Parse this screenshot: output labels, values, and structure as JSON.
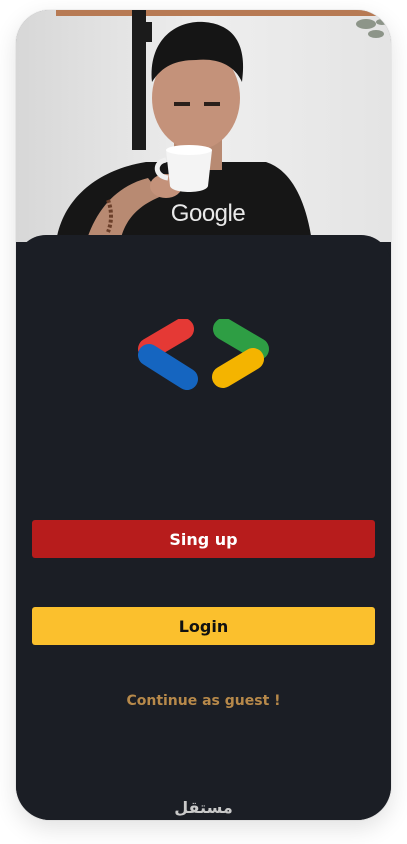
{
  "hero": {
    "shirt_text": "Google"
  },
  "actions": {
    "signup_label": "Sing up",
    "login_label": "Login",
    "guest_label": "Continue as guest !"
  },
  "watermark": {
    "text": "مستقل"
  },
  "colors": {
    "background": "#1b1e25",
    "signup": "#b71c1c",
    "login": "#fbc02d",
    "guest_text": "#b7894a",
    "logo_red": "#e53935",
    "logo_blue": "#1565c0",
    "logo_green": "#2e9e44",
    "logo_yellow": "#f4b400"
  }
}
